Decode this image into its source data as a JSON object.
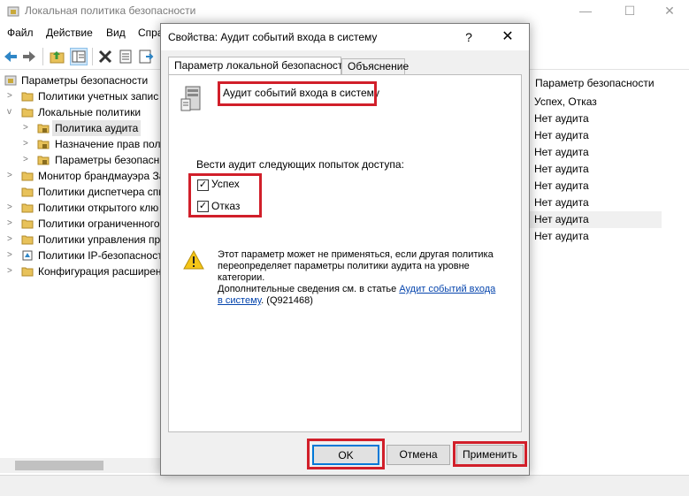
{
  "window": {
    "title": "Локальная политика безопасности",
    "controls": [
      "—",
      "☐",
      "✕"
    ]
  },
  "menu": [
    "Файл",
    "Действие",
    "Вид",
    "Спра"
  ],
  "tree": {
    "items": [
      {
        "label": "Параметры безопасности",
        "level": 0,
        "expander": "none"
      },
      {
        "label": "Политики учетных запис",
        "level": 1,
        "expander": ">"
      },
      {
        "label": "Локальные политики",
        "level": 1,
        "expander": "v"
      },
      {
        "label": "Политика аудита",
        "level": 2,
        "expander": ">",
        "selected": true
      },
      {
        "label": "Назначение прав поли",
        "level": 2,
        "expander": ">"
      },
      {
        "label": "Параметры безопасн",
        "level": 2,
        "expander": ">"
      },
      {
        "label": "Монитор брандмауэра За",
        "level": 1,
        "expander": ">"
      },
      {
        "label": "Политики диспетчера спи",
        "level": 1,
        "expander": ""
      },
      {
        "label": "Политики открытого клю",
        "level": 1,
        "expander": ">"
      },
      {
        "label": "Политики ограниченного",
        "level": 1,
        "expander": ">"
      },
      {
        "label": "Политики управления пр",
        "level": 1,
        "expander": ">"
      },
      {
        "label": "Политики IP-безопасност",
        "level": 1,
        "expander": ">"
      },
      {
        "label": "Конфигурация расширен",
        "level": 1,
        "expander": ">"
      }
    ]
  },
  "right_pane": {
    "header": "Параметр безопасности",
    "rows": [
      "Успех, Отказ",
      "Нет аудита",
      "Нет аудита",
      "Нет аудита",
      "Нет аудита",
      "Нет аудита",
      "Нет аудита",
      "Нет аудита",
      "Нет аудита"
    ],
    "selected_index": 7
  },
  "dialog": {
    "title": "Свойства: Аудит событий входа в систему",
    "help": "?",
    "close": "✕",
    "tabs": [
      "Параметр локальной безопасности",
      "Объяснение"
    ],
    "policy_name": "Аудит событий входа в систему",
    "audit_label": "Вести аудит следующих попыток доступа:",
    "success_label": "Успех",
    "success_checked": true,
    "failure_label": "Отказ",
    "failure_checked": true,
    "warning": {
      "line1": "Этот параметр может не применяться, если другая политика",
      "line2": "переопределяет параметры политики аудита на уровне",
      "line3": "категории.",
      "line4_prefix": "Дополнительные сведения см. в статье ",
      "link_part1": "Аудит событий входа",
      "link_part2": "в систему",
      "line5_suffix": ". (Q921468)"
    },
    "buttons": {
      "ok": "OK",
      "cancel": "Отмена",
      "apply": "Применить"
    }
  },
  "highlight_color": "#d11f2a"
}
